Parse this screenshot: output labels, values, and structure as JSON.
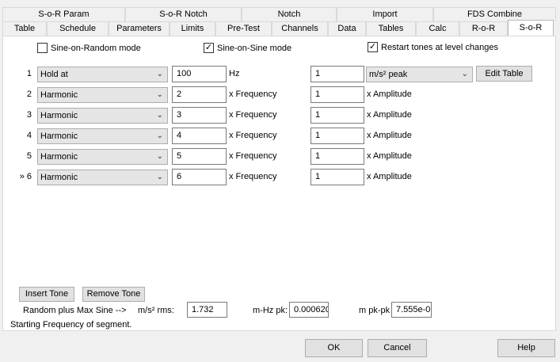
{
  "tabs_row1": [
    {
      "label": "S-o-R Param"
    },
    {
      "label": "S-o-R Notch"
    },
    {
      "label": "Notch"
    },
    {
      "label": "Import"
    },
    {
      "label": "FDS Combine"
    }
  ],
  "tabs_row2": [
    {
      "label": "Table"
    },
    {
      "label": "Schedule"
    },
    {
      "label": "Parameters"
    },
    {
      "label": "Limits"
    },
    {
      "label": "Pre-Test"
    },
    {
      "label": "Channels"
    },
    {
      "label": "Data"
    },
    {
      "label": "Tables"
    },
    {
      "label": "Calc"
    },
    {
      "label": "R-o-R"
    },
    {
      "label": "S-o-R"
    }
  ],
  "checkboxes": {
    "sine_on_random": {
      "label": "Sine-on-Random mode",
      "checked": false,
      "mark": ""
    },
    "sine_on_sine": {
      "label": "Sine-on-Sine mode",
      "checked": true,
      "mark": "✓"
    },
    "restart_tones": {
      "label": "Restart tones at level changes",
      "checked": true,
      "mark": "✓"
    }
  },
  "rows": [
    {
      "num": "1",
      "type": "Hold at",
      "value": "100",
      "unit": "Hz",
      "amp": "1",
      "amp_label": ""
    },
    {
      "num": "2",
      "type": "Harmonic",
      "value": "2",
      "unit": "x Frequency",
      "amp": "1",
      "amp_label": "x Amplitude"
    },
    {
      "num": "3",
      "type": "Harmonic",
      "value": "3",
      "unit": "x Frequency",
      "amp": "1",
      "amp_label": "x Amplitude"
    },
    {
      "num": "4",
      "type": "Harmonic",
      "value": "4",
      "unit": "x Frequency",
      "amp": "1",
      "amp_label": "x Amplitude"
    },
    {
      "num": "5",
      "type": "Harmonic",
      "value": "5",
      "unit": "x Frequency",
      "amp": "1",
      "amp_label": "x Amplitude"
    },
    {
      "num": "» 6",
      "type": "Harmonic",
      "value": "6",
      "unit": "x Frequency",
      "amp": "1",
      "amp_label": "x Amplitude"
    }
  ],
  "amp_unit_select": "m/s² peak",
  "edit_table_label": "Edit Table",
  "insert_tone_label": "Insert Tone",
  "remove_tone_label": "Remove Tone",
  "summary": {
    "label": "Random plus Max Sine -->",
    "rms_label": "m/s² rms:",
    "rms_value": "1.732",
    "mhz_label": "m-Hz pk:",
    "mhz_value": "0.000620",
    "pkpk_label": "m pk-pk",
    "pkpk_value": "7.555e-0"
  },
  "status_text": "Starting Frequency of segment.",
  "footer": {
    "ok": "OK",
    "cancel": "Cancel",
    "help": "Help"
  }
}
